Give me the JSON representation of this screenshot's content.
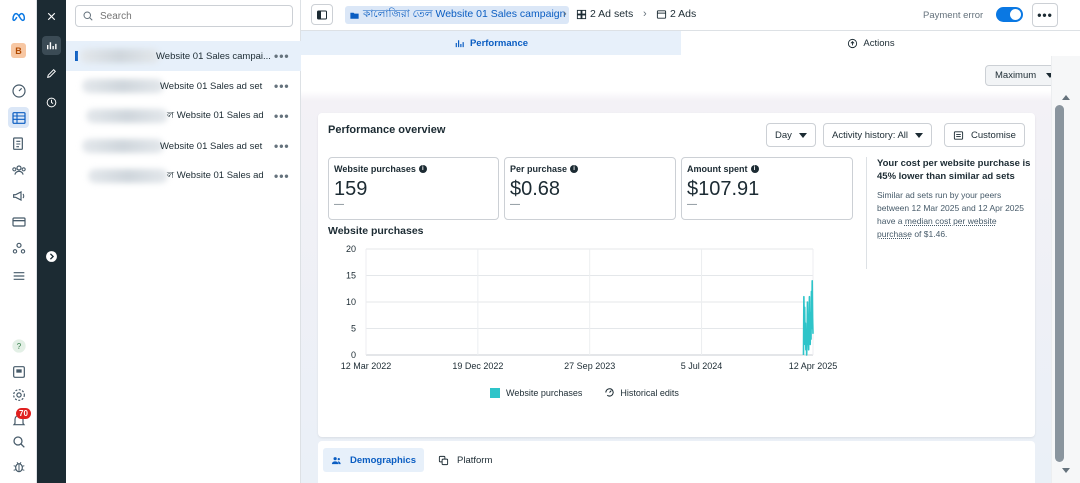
{
  "rail": {
    "account_initial": "B",
    "notification_count": "70"
  },
  "tree": {
    "search_placeholder": "Search",
    "rows": [
      {
        "label": "Website 01 Sales campai...",
        "more": "•••"
      },
      {
        "label": "Website 01 Sales ad set",
        "more": "•••"
      },
      {
        "label": "ল Website 01 Sales ad",
        "more": "•••"
      },
      {
        "label": "Website 01 Sales ad set",
        "more": "•••"
      },
      {
        "label": "ল Website 01 Sales ad",
        "more": "•••"
      }
    ]
  },
  "header": {
    "campaign": "কালোজিরা তেল Website 01 Sales campaign",
    "ad_sets": "2 Ad sets",
    "ads": "2 Ads",
    "payment_error": "Payment error",
    "more": "•••"
  },
  "tabs": {
    "performance": "Performance",
    "actions": "Actions"
  },
  "main": {
    "range_select": "Maximum"
  },
  "overview": {
    "title": "Performance overview",
    "day_select": "Day",
    "activity_select": "Activity history: All",
    "customise": "Customise",
    "metrics": [
      {
        "label": "Website purchases",
        "value": "159",
        "dash": "—"
      },
      {
        "label": "Per purchase",
        "value": "$0.68",
        "dash": "—"
      },
      {
        "label": "Amount spent",
        "value": "$107.91",
        "dash": "—"
      }
    ],
    "insight": {
      "headline": "Your cost per website purchase is 45% lower than similar ad sets",
      "body_1": "Similar ad sets run by your peers between 12 Mar 2025 and 12 Apr 2025 have a ",
      "body_link": "median cost per website purchase",
      "body_2": " of $1.46."
    },
    "chart_title": "Website purchases",
    "legend_series": "Website purchases",
    "legend_edits": "Historical edits"
  },
  "chart_data": {
    "type": "line",
    "title": "Website purchases",
    "xlabel": "",
    "ylabel": "",
    "ylim": [
      0,
      20
    ],
    "yticks": [
      0,
      5,
      10,
      15,
      20
    ],
    "xticks": [
      "12 Mar 2022",
      "19 Dec 2022",
      "27 Sep 2023",
      "5 Jul 2024",
      "12 Apr 2025"
    ],
    "grid": true,
    "legend": "bottom",
    "series": [
      {
        "name": "Website purchases",
        "color": "#2ec4c9",
        "x": [
          "2025-03-19",
          "2025-03-20",
          "2025-03-21",
          "2025-03-22",
          "2025-03-23",
          "2025-03-24",
          "2025-03-25",
          "2025-03-26",
          "2025-03-27",
          "2025-03-28",
          "2025-03-29",
          "2025-03-30",
          "2025-03-31",
          "2025-04-01",
          "2025-04-02",
          "2025-04-03",
          "2025-04-04",
          "2025-04-05",
          "2025-04-06",
          "2025-04-07",
          "2025-04-08",
          "2025-04-09",
          "2025-04-10",
          "2025-04-11",
          "2025-04-12"
        ],
        "y": [
          0,
          11,
          5,
          9,
          2,
          6,
          1,
          4,
          0,
          3,
          10,
          2,
          7,
          1,
          6,
          11,
          4,
          2,
          8,
          3,
          12,
          5,
          14,
          7,
          4
        ]
      }
    ]
  },
  "bottom": {
    "demographics": "Demographics",
    "platform": "Platform"
  }
}
